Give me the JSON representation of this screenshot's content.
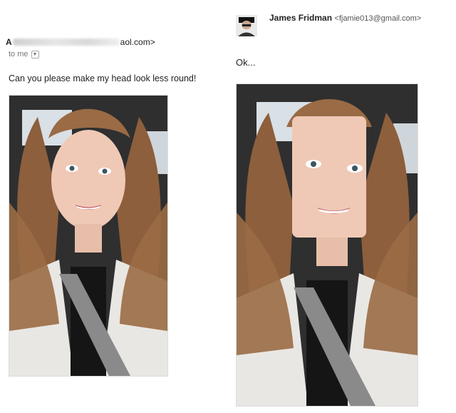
{
  "left_email": {
    "sender_initial": "A",
    "sender_domain": "aol.com>",
    "to_label": "to me",
    "message": "Can you please make my head look less round!"
  },
  "right_email": {
    "sender_name": "James Fridman",
    "sender_email": "<fjamie013@gmail.com>",
    "message": "Ok..."
  },
  "colors": {
    "hair": "#9a6b45",
    "skin": "#efc9b6",
    "cardigan": "#e9e7e3",
    "car_interior": "#3a3a3a",
    "sky": "#dfe6ee"
  }
}
